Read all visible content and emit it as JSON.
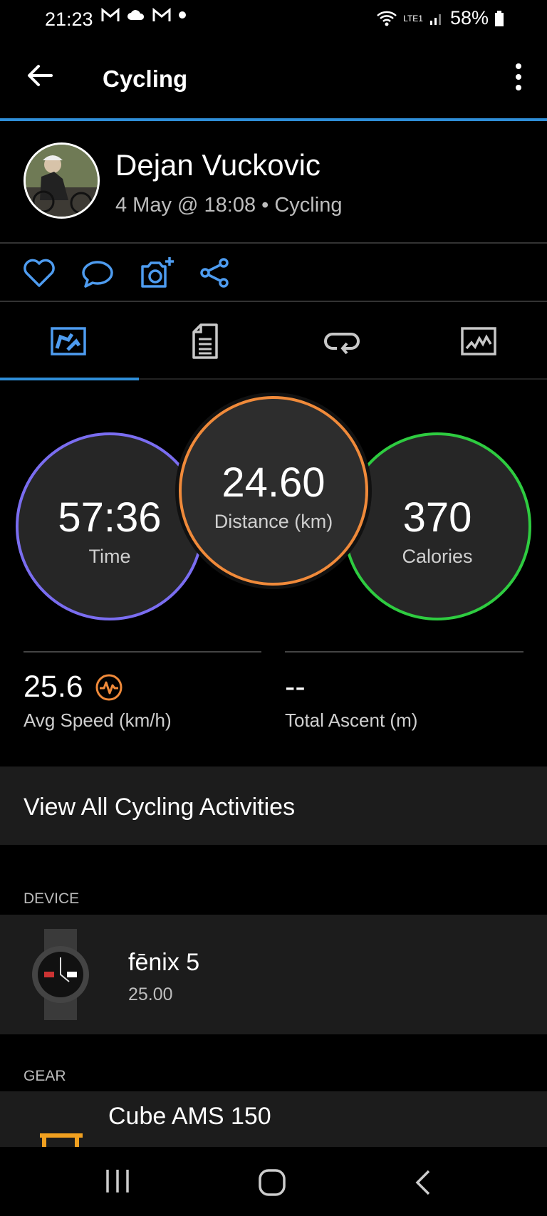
{
  "status": {
    "time": "21:23",
    "battery": "58%",
    "network": "LTE1"
  },
  "appbar": {
    "title": "Cycling"
  },
  "activity": {
    "user": "Dejan Vuckovic",
    "subtitle": "4 May @ 18:08 • Cycling"
  },
  "metrics": {
    "time": {
      "value": "57:36",
      "label": "Time"
    },
    "distance": {
      "value": "24.60",
      "label": "Distance (km)"
    },
    "calories": {
      "value": "370",
      "label": "Calories"
    }
  },
  "stats": {
    "avg_speed": {
      "value": "25.6",
      "label": "Avg Speed (km/h)"
    },
    "total_ascent": {
      "value": "--",
      "label": "Total Ascent (m)"
    }
  },
  "view_all": "View All Cycling Activities",
  "device": {
    "header": "DEVICE",
    "name": "fēnix 5",
    "version": "25.00"
  },
  "gear": {
    "header": "GEAR",
    "name": "Cube AMS 150"
  },
  "colors": {
    "accent": "#2f8ed8",
    "time": "#7a6df0",
    "distance": "#f08a3a",
    "calories": "#2ecc40"
  }
}
